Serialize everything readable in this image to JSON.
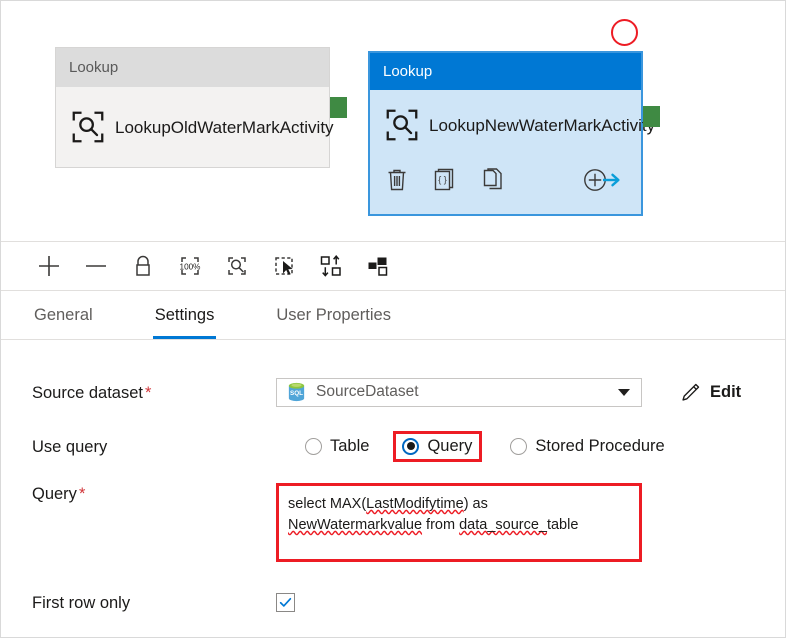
{
  "canvas": {
    "nodes": [
      {
        "type_label": "Lookup",
        "name": "LookupOldWaterMarkActivity",
        "icon": "lookup-magnifier-icon",
        "selected": false
      },
      {
        "type_label": "Lookup",
        "name": "LookupNewWaterMarkActivity",
        "icon": "lookup-magnifier-icon",
        "selected": true,
        "actions": [
          {
            "name": "delete-activity-icon",
            "label": "Delete"
          },
          {
            "name": "code-activity-icon",
            "label": "Code"
          },
          {
            "name": "clone-activity-icon",
            "label": "Clone"
          },
          {
            "name": "add-output-icon",
            "label": "Add output"
          }
        ]
      }
    ],
    "annotation": {
      "name": "red-circle-annotation",
      "color": "#ed1c24"
    },
    "connector_color": "#3f8a43",
    "selected_header_color": "#0078d4"
  },
  "toolbar": {
    "buttons": [
      {
        "name": "zoom-in-icon",
        "label": "Zoom in"
      },
      {
        "name": "zoom-out-icon",
        "label": "Zoom out"
      },
      {
        "name": "lock-icon",
        "label": "Lock"
      },
      {
        "name": "zoom-to-100-percent-icon",
        "label": "100%"
      },
      {
        "name": "zoom-to-fit-icon",
        "label": "Zoom to fit"
      },
      {
        "name": "select-mode-icon",
        "label": "Select"
      },
      {
        "name": "auto-align-icon",
        "label": "Auto align"
      },
      {
        "name": "minimap-icon",
        "label": "Minimap"
      }
    ],
    "zoom_level_label": "100%"
  },
  "panel": {
    "tabs": [
      {
        "label": "General",
        "active": false
      },
      {
        "label": "Settings",
        "active": true
      },
      {
        "label": "User Properties",
        "active": false
      }
    ],
    "accent_color": "#0078d4",
    "fields": {
      "source_dataset": {
        "label": "Source dataset",
        "required_mark": "*",
        "value": "SourceDataset",
        "icon": "sql-database-icon",
        "caret": "chevron-down-icon",
        "edit_label": "Edit",
        "edit_icon": "pencil-icon"
      },
      "use_query": {
        "label": "Use query",
        "options": [
          {
            "label": "Table",
            "selected": false,
            "highlighted": false
          },
          {
            "label": "Query",
            "selected": true,
            "highlighted": true
          },
          {
            "label": "Stored Procedure",
            "selected": false,
            "highlighted": false
          }
        ]
      },
      "query": {
        "label": "Query",
        "required_mark": "*",
        "line1_plain": "select MAX(",
        "line1_misspelled": "LastModifytime",
        "line1_tail": ") as",
        "line2_misspelled": "NewWatermarkvalue",
        "line2_mid": " from ",
        "line2_misspelled2": "data_source_",
        "line2_tail": "table",
        "full_value": "select MAX(LastModifytime) as NewWatermarkvalue from data_source_table",
        "highlighted": true,
        "highlight_color": "#ed1c24"
      },
      "first_row_only": {
        "label": "First row only",
        "checked": true,
        "check_icon": "checkmark-icon",
        "check_color": "#0078d4"
      }
    }
  }
}
